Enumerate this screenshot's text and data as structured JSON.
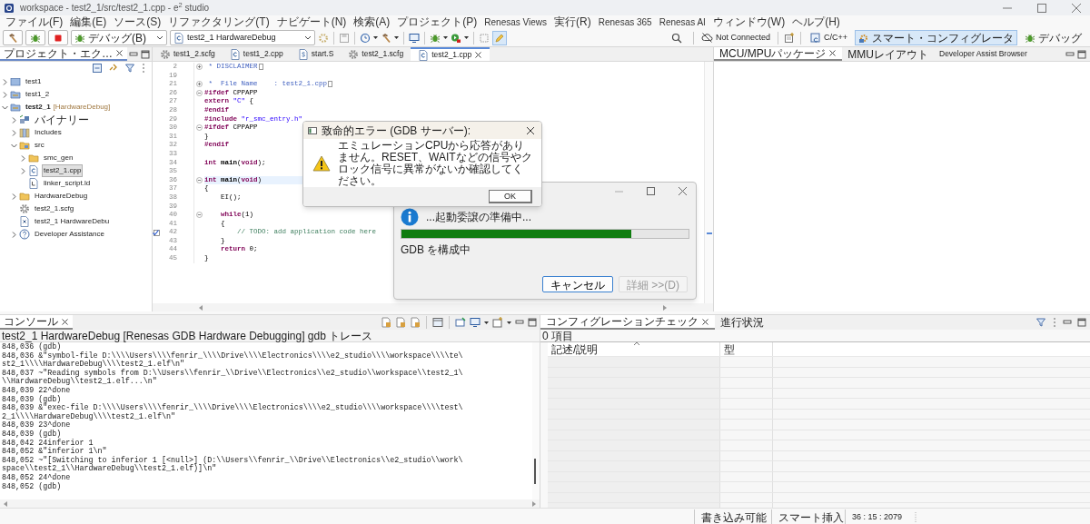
{
  "window": {
    "title": "workspace - test2_1/src/test2_1.cpp - e$^{2}$ studio"
  },
  "menu": [
    "ファイル(F)",
    "編集(E)",
    "ソース(S)",
    "リファクタリング(T)",
    "ナビゲート(N)",
    "検索(A)",
    "プロジェクト(P)",
    "Renesas Views",
    "実行(R)",
    "Renesas 365",
    "Renesas AI",
    "ウィンドウ(W)",
    "ヘルプ(H)"
  ],
  "toolbar": {
    "launch_mode": "デバッグ(B)",
    "launch_config": "test2_1 HardwareDebug",
    "connection": "Not Connected",
    "perspectives": [
      {
        "label": "C/C++",
        "selected": false
      },
      {
        "label": "スマート・コンフィグレータ",
        "selected": true
      },
      {
        "label": "デバッグ",
        "selected": false
      }
    ]
  },
  "project_explorer": {
    "tab": {
      "label": "プロジェクト・エク…",
      "selected": true
    },
    "tree": [
      {
        "label": "test1",
        "kind": "project-closed",
        "expanded": false,
        "selected": false
      },
      {
        "label": "test1_2",
        "kind": "project",
        "expanded": false,
        "selected": false
      },
      {
        "label": "test2_1",
        "decoration": "[HardwareDebug]",
        "kind": "project",
        "expanded": true,
        "selected": false,
        "children": [
          {
            "label": "バイナリー",
            "kind": "binary",
            "expanded": false,
            "selected": false
          },
          {
            "label": "Includes",
            "kind": "includes",
            "expanded": false,
            "selected": false
          },
          {
            "label": "src",
            "kind": "source-folder",
            "expanded": true,
            "selected": false,
            "children": [
              {
                "label": "smc_gen",
                "kind": "folder",
                "expanded": false,
                "selected": false
              },
              {
                "label": "test2_1.cpp",
                "kind": "c-file",
                "expanded": false,
                "selected": true
              },
              {
                "label": "linker_script.ld",
                "kind": "ld-file",
                "selected": false
              }
            ]
          },
          {
            "label": "HardwareDebug",
            "kind": "folder",
            "expanded": false,
            "selected": false
          },
          {
            "label": "test2_1.scfg",
            "kind": "gear",
            "selected": false
          },
          {
            "label": "test2_1 HardwareDebu",
            "kind": "launch",
            "selected": false
          },
          {
            "label": "Developer Assistance",
            "kind": "help",
            "expanded": false,
            "selected": false
          }
        ]
      }
    ]
  },
  "editor": {
    "tabs": [
      {
        "label": "test1_2.scfg",
        "kind": "gear",
        "selected": false
      },
      {
        "label": "test1_2.cpp",
        "kind": "c-file",
        "selected": false
      },
      {
        "label": "start.S",
        "kind": "s-file",
        "selected": false
      },
      {
        "label": "test2_1.scfg",
        "kind": "gear",
        "selected": false
      },
      {
        "label": "test2_1.cpp",
        "kind": "c-file",
        "selected": true
      }
    ],
    "lines": [
      {
        "number": "2",
        "folded": true,
        "tokens": [
          {
            "kind": "doc",
            "text": " * DISCLAIMER"
          }
        ]
      },
      {
        "number": "19"
      },
      {
        "number": "21",
        "folded": true,
        "tokens": [
          {
            "kind": "doc",
            "text": " *  File Name    : test2_1.cpp"
          }
        ]
      },
      {
        "number": "26",
        "folded": false,
        "tokens": [
          {
            "kind": "kw",
            "text": "#ifdef"
          },
          {
            "kind": "plain",
            "text": " CPPAPP"
          }
        ]
      },
      {
        "number": "27",
        "tokens": [
          {
            "kind": "kw",
            "text": "extern"
          },
          {
            "kind": "str",
            "text": " \"C\""
          },
          {
            "kind": "plain",
            "text": " {"
          }
        ]
      },
      {
        "number": "28",
        "tokens": [
          {
            "kind": "kw",
            "text": "#endif"
          }
        ]
      },
      {
        "number": "29",
        "tokens": [
          {
            "kind": "kw",
            "text": "#include"
          },
          {
            "kind": "str",
            "text": " \"r_smc_entry.h\""
          }
        ]
      },
      {
        "number": "30",
        "folded": false,
        "tokens": [
          {
            "kind": "kw",
            "text": "#ifdef"
          },
          {
            "kind": "plain",
            "text": " CPPAPP"
          }
        ]
      },
      {
        "number": "31",
        "tokens": [
          {
            "kind": "plain",
            "text": "}"
          }
        ]
      },
      {
        "number": "32",
        "tokens": [
          {
            "kind": "kw",
            "text": "#endif"
          }
        ]
      },
      {
        "number": "33"
      },
      {
        "number": "34",
        "tokens": [
          {
            "kind": "kw",
            "text": "int"
          },
          {
            "kind": "fn",
            "text": " main"
          },
          {
            "kind": "plain",
            "text": "("
          },
          {
            "kind": "kw",
            "text": "void"
          },
          {
            "kind": "plain",
            "text": ");"
          }
        ]
      },
      {
        "number": "35"
      },
      {
        "number": "36",
        "folded": false,
        "current": true,
        "tokens": [
          {
            "kind": "kw",
            "text": "int"
          },
          {
            "kind": "fn",
            "text": " main"
          },
          {
            "kind": "plain",
            "text": "("
          },
          {
            "kind": "kw",
            "text": "void"
          },
          {
            "kind": "plain",
            "text": ")"
          }
        ]
      },
      {
        "number": "37",
        "tokens": [
          {
            "kind": "plain",
            "text": "{"
          }
        ]
      },
      {
        "number": "38",
        "tokens": [
          {
            "kind": "plain",
            "text": "    EI();"
          }
        ]
      },
      {
        "number": "39"
      },
      {
        "number": "40",
        "folded": false,
        "tokens": [
          {
            "kind": "kw",
            "text": "    while"
          },
          {
            "kind": "plain",
            "text": "(1)"
          }
        ]
      },
      {
        "number": "41",
        "tokens": [
          {
            "kind": "plain",
            "text": "    {"
          }
        ]
      },
      {
        "number": "42",
        "task": true,
        "tokens": [
          {
            "kind": "comment",
            "text": "        // TODO: add application code here"
          }
        ]
      },
      {
        "number": "43",
        "tokens": [
          {
            "kind": "plain",
            "text": "    }"
          }
        ]
      },
      {
        "number": "44",
        "tokens": [
          {
            "kind": "kw",
            "text": "    return"
          },
          {
            "kind": "plain",
            "text": " 0;"
          }
        ]
      },
      {
        "number": "45",
        "tokens": [
          {
            "kind": "plain",
            "text": "}"
          }
        ]
      }
    ]
  },
  "right_panel": {
    "tabs": [
      {
        "label": "MCU/MPUパッケージ",
        "selected": true
      },
      {
        "label": "MMUレイアウト",
        "selected": false
      },
      {
        "label": "Developer Assist Browser",
        "selected": false
      }
    ]
  },
  "console": {
    "tab": {
      "label": "コンソール",
      "selected": true
    },
    "description": "test2_1 HardwareDebug [Renesas GDB Hardware Debugging] gdb トレース",
    "lines": [
      "848,036 (gdb)",
      "848,036 &\"symbol-file D:\\\\\\\\Users\\\\\\\\fenrir_\\\\\\\\Drive\\\\\\\\Electronics\\\\\\\\e2_studio\\\\\\\\workspace\\\\\\\\te\\",
      "st2_1\\\\\\\\HardwareDebug\\\\\\\\test2_1.elf\\n\"",
      "848,037 ~\"Reading symbols from D:\\\\Users\\\\fenrir_\\\\Drive\\\\Electronics\\\\e2_studio\\\\workspace\\\\test2_1\\",
      "\\\\HardwareDebug\\\\test2_1.elf...\\n\"",
      "848,039 22^done",
      "848,039 (gdb)",
      "848,039 &\"exec-file D:\\\\\\\\Users\\\\\\\\fenrir_\\\\\\\\Drive\\\\\\\\Electronics\\\\\\\\e2_studio\\\\\\\\workspace\\\\\\\\test\\",
      "2_1\\\\\\\\HardwareDebug\\\\\\\\test2_1.elf\\n\"",
      "848,039 23^done",
      "848,039 (gdb)",
      "848,042 24inferior 1",
      "848,052 &\"inferior 1\\n\"",
      "848,052 ~\"[Switching to inferior 1 [<null>] (D:\\\\Users\\\\fenrir_\\\\Drive\\\\Electronics\\\\e2_studio\\\\work\\",
      "space\\\\test2_1\\\\HardwareDebug\\\\test2_1.elf)]\\n\"",
      "848,052 24^done",
      "848,052 (gdb)"
    ]
  },
  "config_check": {
    "tabs": [
      {
        "label": "コンフィグレーションチェック",
        "selected": true
      },
      {
        "label": "進行状況",
        "selected": false
      }
    ],
    "count": "0 項目",
    "columns": [
      "記述/説明",
      "型"
    ]
  },
  "status_bar": [
    "書き込み可能",
    "スマート挿入",
    "36 : 15 : 2079"
  ],
  "error_dialog": {
    "title": "致命的エラー (GDB サーバー):",
    "message": "エミュレーションCPUから応答がありません。RESET、WAITなどの信号やクロック信号に異常がないか確認してください。",
    "button": "OK"
  },
  "progress_dialog": {
    "message": "...起動委譲の準備中...",
    "level": 0.8,
    "task": "GDB を構成中",
    "buttons": [
      {
        "label": "キャンセル",
        "disabled": false
      },
      {
        "label": "詳細 >>(D)",
        "disabled": true
      }
    ]
  }
}
